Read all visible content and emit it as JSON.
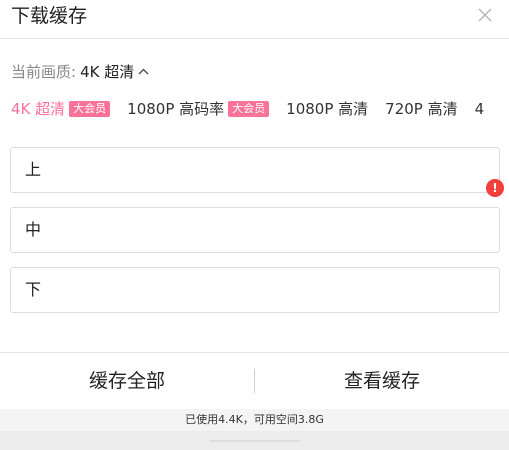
{
  "header": {
    "title": "下载缓存"
  },
  "quality": {
    "label": "当前画质:",
    "value": "4K 超清"
  },
  "options": [
    {
      "label": "4K 超清",
      "badge": "大会员",
      "selected": true
    },
    {
      "label": "1080P 高码率",
      "badge": "大会员",
      "selected": false
    },
    {
      "label": "1080P 高清",
      "badge": "",
      "selected": false
    },
    {
      "label": "720P 高清",
      "badge": "",
      "selected": false
    },
    {
      "label": "4",
      "badge": "",
      "selected": false
    }
  ],
  "episodes": [
    {
      "label": "上"
    },
    {
      "label": "中"
    },
    {
      "label": "下"
    }
  ],
  "warning": {
    "symbol": "!"
  },
  "actions": {
    "cache_all": "缓存全部",
    "view_cache": "查看缓存"
  },
  "storage": {
    "text": "已使用4.4K，可用空间3.8G"
  },
  "colors": {
    "accent": "#fb7299",
    "warning": "#f1403c"
  },
  "icons": {
    "close": "close-icon",
    "chevron": "chevron-up-icon",
    "warning": "warning-icon"
  }
}
